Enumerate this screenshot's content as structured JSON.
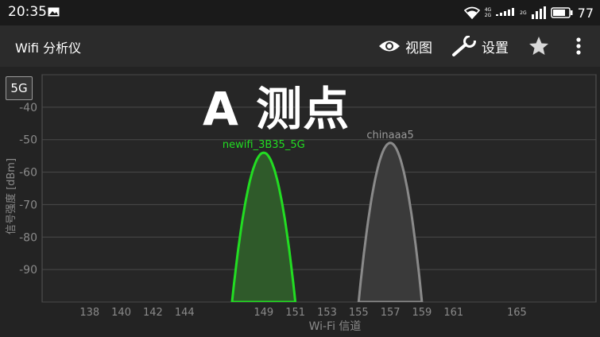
{
  "status_bar": {
    "time": "20:35",
    "battery": "77",
    "icons": [
      "gallery-icon",
      "wifi-icon",
      "signal-4g-icon",
      "signal-2g-icon",
      "battery-icon"
    ],
    "net_labels": {
      "top": "4G",
      "bottom": "2G",
      "second": "2G"
    }
  },
  "app_bar": {
    "title": "Wifi 分析仪",
    "view_label": "视图",
    "settings_label": "设置",
    "icons": [
      "eye-icon",
      "wrench-icon",
      "star-icon",
      "more-vert-icon"
    ]
  },
  "band_button": "5G",
  "overlay_title": "A 测点",
  "chart_data": {
    "type": "area",
    "xlabel": "Wi-Fi 信道",
    "ylabel": "信号强度 [dBm]",
    "ylim": [
      -100,
      -30
    ],
    "yticks": [
      -40,
      -50,
      -60,
      -70,
      -80,
      -90
    ],
    "xticks": [
      138,
      140,
      142,
      144,
      149,
      151,
      153,
      155,
      157,
      159,
      161,
      165
    ],
    "grid": true,
    "series": [
      {
        "name": "newifi_3B35_5G",
        "center_channel": 149,
        "signal_dbm": -54,
        "color": "#22dd22",
        "fill": "#2f5a2a"
      },
      {
        "name": "chinaaa5",
        "center_channel": 157,
        "signal_dbm": -51,
        "color": "#8a8a8a",
        "fill": "#3a3a3a"
      }
    ]
  }
}
